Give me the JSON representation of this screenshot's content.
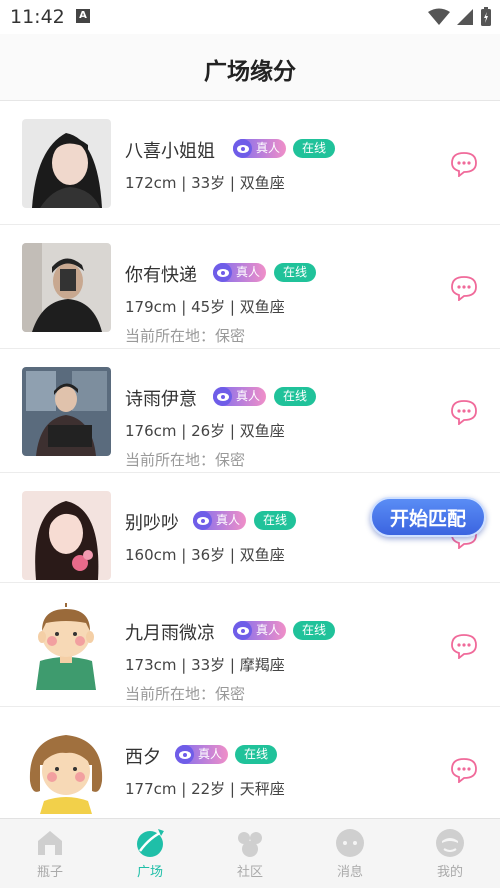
{
  "status_bar": {
    "time": "11:42",
    "notif_letter": "A"
  },
  "header": {
    "title": "广场缘分"
  },
  "badges": {
    "real": "真人",
    "online": "在线"
  },
  "users": [
    {
      "name": "八喜小姐姐",
      "info": "172cm | 33岁 | 双鱼座",
      "location": ""
    },
    {
      "name": "你有快递",
      "info": "179cm | 45岁 | 双鱼座",
      "location": "当前所在地：保密"
    },
    {
      "name": "诗雨伊意",
      "info": "176cm | 26岁 | 双鱼座",
      "location": "当前所在地：保密"
    },
    {
      "name": "别吵吵",
      "info": "160cm | 36岁 | 双鱼座",
      "location": ""
    },
    {
      "name": "九月雨微凉",
      "info": "173cm | 33岁 | 摩羯座",
      "location": "当前所在地：保密"
    },
    {
      "name": "西夕",
      "info": "177cm | 22岁 | 天秤座",
      "location": ""
    }
  ],
  "match_button": {
    "label": "开始匹配"
  },
  "nav": [
    {
      "label": "瓶子",
      "icon": "bottle-icon"
    },
    {
      "label": "广场",
      "icon": "plaza-icon"
    },
    {
      "label": "社区",
      "icon": "community-icon"
    },
    {
      "label": "消息",
      "icon": "message-icon"
    },
    {
      "label": "我的",
      "icon": "profile-icon"
    }
  ],
  "colors": {
    "accent": "#1fbfa8",
    "online": "#20c29a",
    "chat": "#f06a9a"
  }
}
